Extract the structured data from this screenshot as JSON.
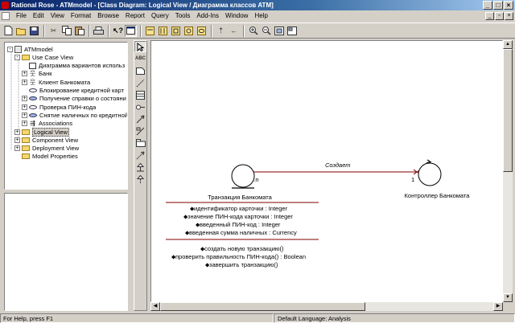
{
  "window": {
    "title": "Rational Rose - ATMmodel - [Class Diagram: Logical View / Диаграмма классов ATM]"
  },
  "menu": [
    "File",
    "Edit",
    "View",
    "Format",
    "Browse",
    "Report",
    "Query",
    "Tools",
    "Add-Ins",
    "Window",
    "Help"
  ],
  "toolbar": {
    "icons": [
      "new-icon",
      "open-icon",
      "save-icon",
      "cut-icon",
      "copy-icon",
      "paste-icon",
      "print-icon",
      "context-help-icon",
      "view-doc-icon",
      "browse-class-icon",
      "browse-interaction-icon",
      "browse-component-icon",
      "browse-deployment-icon",
      "browse-parent-icon",
      "browse-previous-icon",
      "zoom-in-icon",
      "zoom-out-icon",
      "fit-window-icon",
      "undo-fit-icon"
    ]
  },
  "browser": {
    "items": [
      {
        "label": "ATMmodel",
        "icon": "model-icon",
        "level": 0,
        "expander": "-"
      },
      {
        "label": "Use Case View",
        "icon": "folder-icon",
        "level": 1,
        "expander": "-"
      },
      {
        "label": "Диаграмма вариантов использ",
        "icon": "diagram-icon",
        "level": 2,
        "expander": ""
      },
      {
        "label": "Банк",
        "icon": "actor-icon",
        "level": 2,
        "expander": "+"
      },
      {
        "label": "Клиент Банкомата",
        "icon": "actor-icon",
        "level": 2,
        "expander": "+"
      },
      {
        "label": "Блокирование кредитной карт",
        "icon": "usecase-icon-hollow",
        "level": 2,
        "expander": ""
      },
      {
        "label": "Получение справки о состояни",
        "icon": "usecase-icon",
        "level": 2,
        "expander": "+"
      },
      {
        "label": "Проверка ПИН-кода",
        "icon": "usecase-icon-hollow",
        "level": 2,
        "expander": "+"
      },
      {
        "label": "Снятие наличных по кредитной",
        "icon": "usecase-icon",
        "level": 2,
        "expander": "+"
      },
      {
        "label": "Associations",
        "icon": "association-icon",
        "level": 2,
        "expander": "+"
      },
      {
        "label": "Logical View",
        "icon": "folder-icon",
        "level": 1,
        "expander": "+",
        "selected": true
      },
      {
        "label": "Component View",
        "icon": "folder-icon",
        "level": 1,
        "expander": "+"
      },
      {
        "label": "Deployment View",
        "icon": "folder-icon",
        "level": 1,
        "expander": "+"
      },
      {
        "label": "Model Properties",
        "icon": "folder-icon",
        "level": 1,
        "expander": ""
      }
    ]
  },
  "palette": {
    "icons": [
      "selection-arrow-icon",
      "text-box-icon",
      "note-icon",
      "anchor-note-icon",
      "class-icon",
      "interface-icon",
      "unidirectional-association-icon",
      "association-class-icon",
      "package-icon",
      "dependency-icon",
      "generalization-icon",
      "realize-icon"
    ],
    "text_label": "ABC"
  },
  "diagram": {
    "class1": {
      "name": "Транзакция Банкомата",
      "attributes": [
        "идентификатор карточки : Integer",
        "значение ПИН-кода карточки : Integer",
        "введенный ПИН-код : Integer",
        "введенная сумма наличных : Currency"
      ],
      "operations": [
        "создать новую транзакцию()",
        "проверить правильность ПИН-кода() : Boolean",
        "завершить транзакцию()"
      ]
    },
    "class2": {
      "name": "Контроллер Банкомата"
    },
    "association": {
      "label": "Создает",
      "mult_left": "1..n",
      "mult_right": "1"
    }
  },
  "status": {
    "help": "For Help, press F1",
    "language": "Default Language: Analysis"
  }
}
